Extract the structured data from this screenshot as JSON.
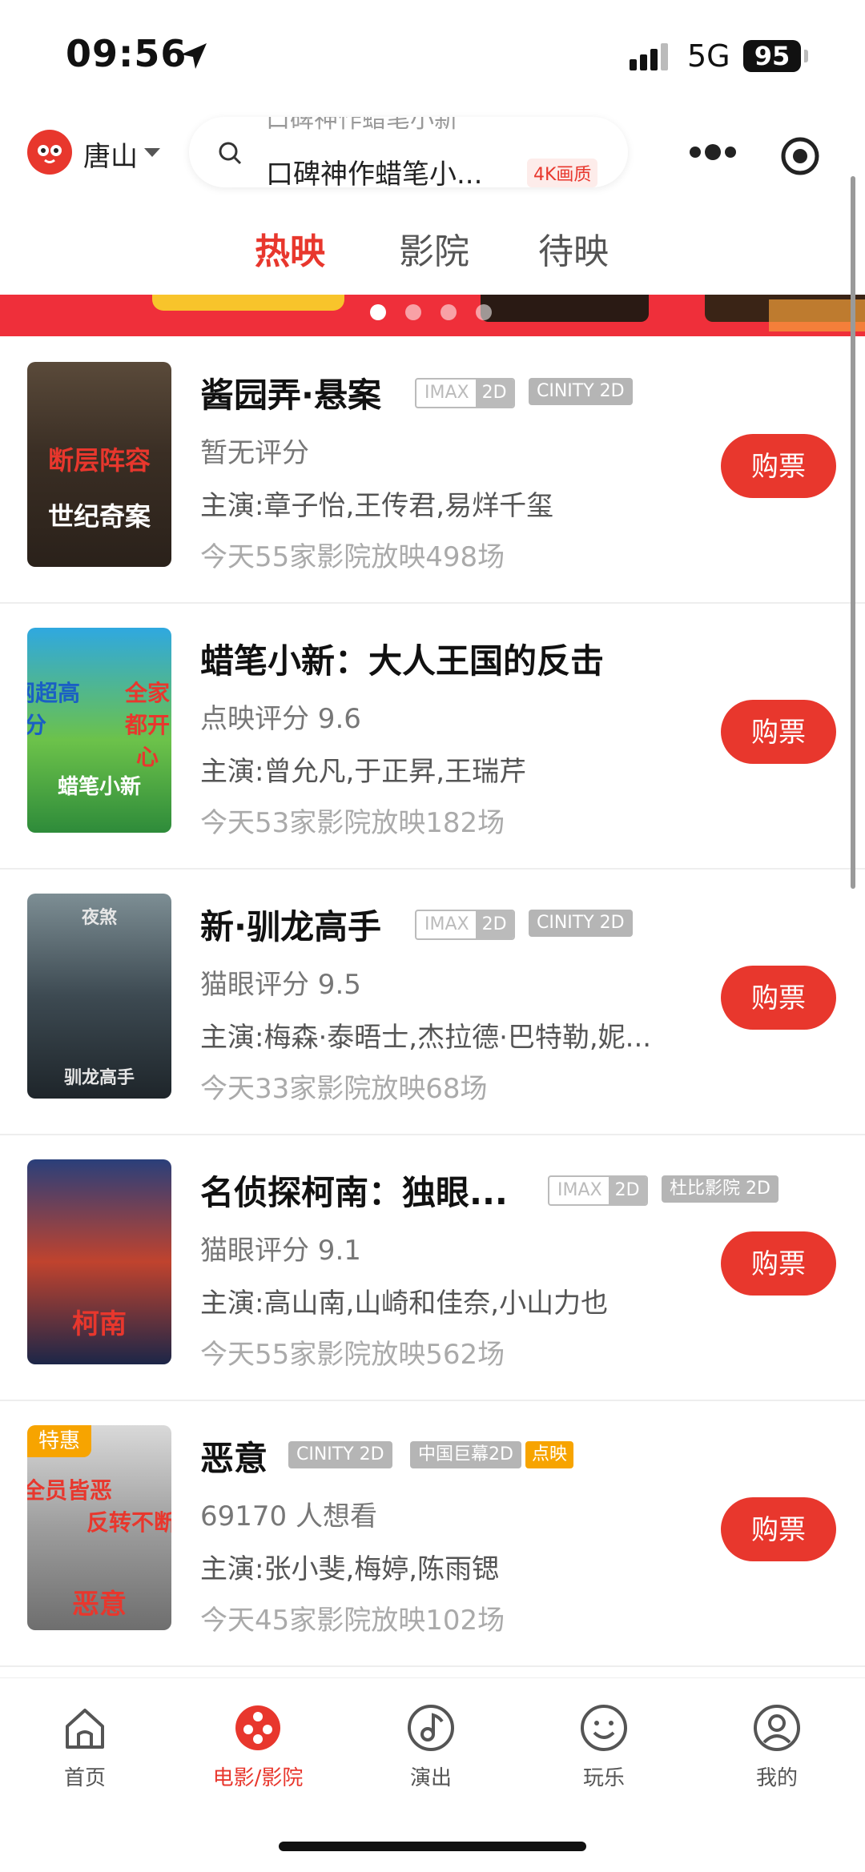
{
  "status_bar": {
    "time": "09:56",
    "network": "5G",
    "battery": "95"
  },
  "header": {
    "city": "唐山",
    "search_ghost": "口碑神作蜡笔小新",
    "search_text": "口碑神作蜡笔小...",
    "search_badge": "4K画质"
  },
  "tabs": [
    {
      "label": "热映",
      "active": true
    },
    {
      "label": "影院",
      "active": false
    },
    {
      "label": "待映",
      "active": false
    }
  ],
  "movies": [
    {
      "title": "酱园弄·悬案",
      "tags": [
        {
          "type": "imax",
          "label": "IMAX",
          "sub": "2D"
        },
        {
          "type": "gray",
          "label": "CINITY 2D"
        }
      ],
      "rating": "暂无评分",
      "cast": "主演:章子怡,王传君,易烊千玺",
      "shows": "今天55家影院放映498场",
      "buy": "购票",
      "poster_text": [
        "断层阵容",
        "世纪奇案"
      ]
    },
    {
      "title": "蜡笔小新：大人王国的反击",
      "tags": [],
      "rating": "点映评分 9.6",
      "cast": "主演:曾允凡,于正昇,王瑞芹",
      "shows": "今天53家影院放映182场",
      "buy": "购票",
      "poster_text": [
        "全网超高分",
        "全家都开心",
        "蜡笔小新"
      ]
    },
    {
      "title": "新·驯龙高手",
      "tags": [
        {
          "type": "imax",
          "label": "IMAX",
          "sub": "2D"
        },
        {
          "type": "gray",
          "label": "CINITY 2D"
        }
      ],
      "rating": "猫眼评分 9.5",
      "cast": "主演:梅森·泰晤士,杰拉德·巴特勒,妮...",
      "shows": "今天33家影院放映68场",
      "buy": "购票",
      "poster_text": [
        "夜煞",
        "驯龙高手"
      ]
    },
    {
      "title": "名侦探柯南：独眼...",
      "tags": [
        {
          "type": "imax",
          "label": "IMAX",
          "sub": "2D"
        },
        {
          "type": "gray",
          "label": "杜比影院 2D"
        }
      ],
      "rating": "猫眼评分 9.1",
      "cast": "主演:高山南,山崎和佳奈,小山力也",
      "shows": "今天55家影院放映562场",
      "buy": "购票",
      "poster_text": [
        "柯南"
      ]
    },
    {
      "title": "恶意",
      "tags": [
        {
          "type": "gray",
          "label": "CINITY 2D"
        },
        {
          "type": "gray",
          "label": "中国巨幕2D"
        },
        {
          "type": "orange",
          "label": "点映"
        }
      ],
      "rating": "69170 人想看",
      "cast": "主演:张小斐,梅婷,陈雨锶",
      "shows": "今天45家影院放映102场",
      "buy": "购票",
      "special_badge": "特惠",
      "poster_text": [
        "全员皆恶",
        "反转不断",
        "恶意"
      ]
    }
  ],
  "tabbar": [
    {
      "label": "首页",
      "icon": "home-icon",
      "active": false
    },
    {
      "label": "电影/影院",
      "icon": "film-reel-icon",
      "active": true
    },
    {
      "label": "演出",
      "icon": "music-note-icon",
      "active": false
    },
    {
      "label": "玩乐",
      "icon": "smile-icon",
      "active": false
    },
    {
      "label": "我的",
      "icon": "user-icon",
      "active": false
    }
  ],
  "colors": {
    "accent": "#e8372d",
    "banner": "#ef2f3a",
    "tag_gray": "#b5b5b5",
    "tag_orange": "#f7a400"
  }
}
